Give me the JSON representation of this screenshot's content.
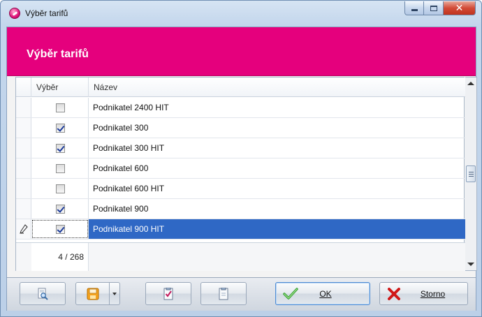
{
  "window": {
    "title": "Výběr tarifů"
  },
  "header": {
    "title": "Výběr tarifů",
    "color": "#e5007d"
  },
  "grid": {
    "columns": {
      "select": "Výběr",
      "name": "Název"
    },
    "rows": [
      {
        "checked": false,
        "name": "Podnikatel 2400 HIT"
      },
      {
        "checked": true,
        "name": "Podnikatel 300"
      },
      {
        "checked": true,
        "name": "Podnikatel 300 HIT"
      },
      {
        "checked": false,
        "name": "Podnikatel 600"
      },
      {
        "checked": false,
        "name": "Podnikatel 600 HIT"
      },
      {
        "checked": true,
        "name": "Podnikatel 900"
      },
      {
        "checked": true,
        "name": "Podnikatel 900 HIT",
        "selected": true,
        "editing": true
      }
    ],
    "count": "4 / 268"
  },
  "buttons": {
    "preview": {
      "icon": "print-preview-icon"
    },
    "save": {
      "icon": "save-icon"
    },
    "check_all": {
      "icon": "check-all-icon"
    },
    "uncheck_all": {
      "icon": "uncheck-all-icon"
    },
    "ok": {
      "label": "OK",
      "icon": "check-icon"
    },
    "cancel": {
      "label": "Storno",
      "icon": "cross-icon"
    }
  }
}
